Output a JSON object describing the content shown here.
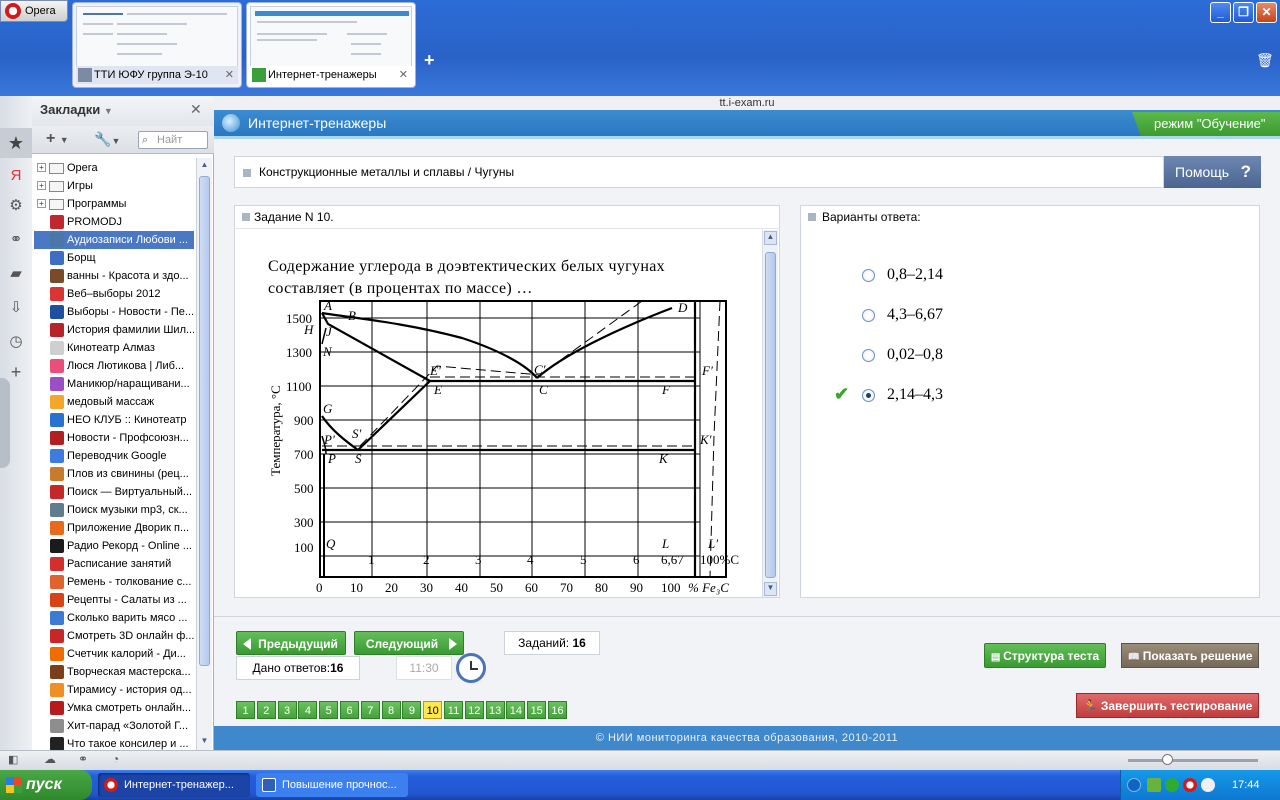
{
  "browser": {
    "menu_label": "Opera",
    "tabs": [
      {
        "label": "ТТИ ЮФУ группа Э-10"
      },
      {
        "label": "Интернет-тренажеры"
      }
    ],
    "new_tab": "+",
    "address": "tt.i-exam.ru",
    "window_buttons": [
      "_",
      "❐",
      "✕"
    ]
  },
  "bookmarks": {
    "title": "Закладки",
    "search_placeholder": "Найт",
    "items": [
      {
        "label": "Opera",
        "type": "folder"
      },
      {
        "label": "Игры",
        "type": "folder"
      },
      {
        "label": "Программы",
        "type": "folder"
      },
      {
        "label": "PROMODJ",
        "color": "#c0282d"
      },
      {
        "label": "Аудиозаписи Любови ...",
        "color": "#4a76a8",
        "selected": true
      },
      {
        "label": "Борщ",
        "color": "#3c6fc4"
      },
      {
        "label": "ванны - Красота и здо...",
        "color": "#7a4b2a"
      },
      {
        "label": "Веб–выборы 2012",
        "color": "#d93535"
      },
      {
        "label": "Выборы - Новости - Пе...",
        "color": "#1f4fa0"
      },
      {
        "label": "История фамилии Шил...",
        "color": "#b8232a"
      },
      {
        "label": "Кинотеатр Алмаз",
        "color": "#cfcfcf"
      },
      {
        "label": "Люся Лютикова | Либ...",
        "color": "#e94f7a"
      },
      {
        "label": "Маникюр/наращивани...",
        "color": "#9b4fc4"
      },
      {
        "label": "медовый массаж",
        "color": "#f2a72b"
      },
      {
        "label": "НЕО КЛУБ :: Кинотеатр",
        "color": "#2a72d0"
      },
      {
        "label": "Новости - Профсоюзн...",
        "color": "#b02020"
      },
      {
        "label": "Переводчик Google",
        "color": "#3c7be0"
      },
      {
        "label": "Плов из свинины (рец...",
        "color": "#c77b2c"
      },
      {
        "label": "Поиск — Виртуальный...",
        "color": "#c62828"
      },
      {
        "label": "Поиск музыки mp3, ск...",
        "color": "#607d8b"
      },
      {
        "label": "Приложение Дворик п...",
        "color": "#e86a1a"
      },
      {
        "label": "Радио Рекорд - Online ...",
        "color": "#1b1b1b"
      },
      {
        "label": "Расписание занятий",
        "color": "#d32f2f"
      },
      {
        "label": "Ремень - толкование с...",
        "color": "#e0622e"
      },
      {
        "label": "Рецепты - Салаты из ...",
        "color": "#d84315"
      },
      {
        "label": "Сколько варить мясо ...",
        "color": "#3b7bd4"
      },
      {
        "label": "Смотреть 3D онлайн ф...",
        "color": "#c62828"
      },
      {
        "label": "Счетчик калорий - Ди...",
        "color": "#ef6c00"
      },
      {
        "label": "Творческая мастерска...",
        "color": "#7b3f1e"
      },
      {
        "label": "Тирамису - история од...",
        "color": "#ef8f24"
      },
      {
        "label": "Умка смотреть онлайн...",
        "color": "#b71c1c"
      },
      {
        "label": "Хит-парад «Золотой Г...",
        "color": "#8d8d8d"
      },
      {
        "label": "Что такое консилер и ...",
        "color": "#222222"
      }
    ]
  },
  "app": {
    "title": "Интернет-тренажеры",
    "mode": "режим \"Обучение\"",
    "breadcrumb": "Конструкционные металлы и сплавы / Чугуны",
    "help": "Помощь",
    "task_header": "Задание N 10.",
    "question": "Содержание углерода в доэвтектических белых чугунах составляет (в процентах по массе) …",
    "answers_header": "Варианты ответа:",
    "answers": [
      {
        "label": "0,8–2,14",
        "selected": false
      },
      {
        "label": "4,3–6,67",
        "selected": false
      },
      {
        "label": "0,02–0,8",
        "selected": false
      },
      {
        "label": "2,14–4,3",
        "selected": true
      }
    ],
    "prev": "Предыдущий",
    "next": "Следующий",
    "tasks_label": "Заданий:",
    "tasks_count": "16",
    "given_label": "Дано ответов:",
    "given_count": "16",
    "timer": "11:30",
    "structure": "Структура теста",
    "solution": "Показать решение",
    "finish": "Завершить тестирование",
    "pages": [
      "1",
      "2",
      "3",
      "4",
      "5",
      "6",
      "7",
      "8",
      "9",
      "10",
      "11",
      "12",
      "13",
      "14",
      "15",
      "16"
    ],
    "current_page": "10",
    "footer": "© НИИ мониторинга качества образования, 2010-2011"
  },
  "diagram": {
    "ylabel": "Температура, °C",
    "yticks": [
      "1500",
      "1300",
      "1100",
      "900",
      "700",
      "500",
      "300",
      "100"
    ],
    "xticks_c": [
      "1",
      "2",
      "3",
      "4",
      "5",
      "6",
      "6,67",
      "100%C"
    ],
    "xticks_fe3c": [
      "0",
      "10",
      "20",
      "30",
      "40",
      "50",
      "60",
      "70",
      "80",
      "90",
      "100",
      "% Fe₃C"
    ],
    "points": [
      "A",
      "B",
      "H",
      "J",
      "N",
      "D",
      "E'",
      "E",
      "C'",
      "C",
      "F'",
      "F",
      "G",
      "S'",
      "P'",
      "P",
      "S",
      "K'",
      "K",
      "Q",
      "L",
      "L'"
    ]
  },
  "taskbar": {
    "start": "пуск",
    "windows": [
      {
        "label": "Интернет-тренажер..."
      },
      {
        "label": "Повышение прочнос..."
      }
    ],
    "clock": "17:44"
  }
}
